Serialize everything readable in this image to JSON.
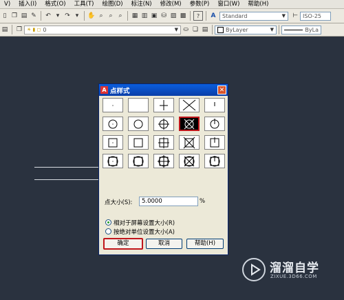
{
  "menubar": {
    "items": [
      "V)",
      "插入(I)",
      "格式(O)",
      "工具(T)",
      "绘图(D)",
      "标注(N)",
      "修改(M)",
      "参数(P)",
      "窗口(W)",
      "帮助(H)"
    ]
  },
  "toolbar1": {
    "text_style": "Standard",
    "dim_style": "ISO-25"
  },
  "toolbar2": {
    "layer": "0",
    "color": "ByLayer",
    "linetype": "ByLa"
  },
  "dialog": {
    "title": "点样式",
    "size_label": "点大小(S):",
    "size_value": "5.0000",
    "size_unit": "%",
    "radio_relative": "相对于屏幕设置大小(R)",
    "radio_absolute": "按绝对单位设置大小(A)",
    "ok_label": "确定",
    "cancel_label": "取消",
    "help_label": "帮助(H)",
    "selected_style_index": 8,
    "point_styles": [
      "dot",
      "none",
      "plus",
      "x",
      "tick",
      "circle-dot",
      "circle",
      "circle-plus",
      "circle-x",
      "circle-tick",
      "square-dot",
      "square",
      "square-plus",
      "square-x",
      "square-tick",
      "circle-square-dot",
      "circle-square",
      "circle-square-plus",
      "circle-square-x",
      "circle-square-tick"
    ]
  },
  "watermark": {
    "title": "溜溜自学",
    "url": "ZIXUE.3D66.COM"
  },
  "colors": {
    "canvas": "#2a323f",
    "annotation_red": "#c0161b",
    "titlebar": "#0a5ede"
  }
}
